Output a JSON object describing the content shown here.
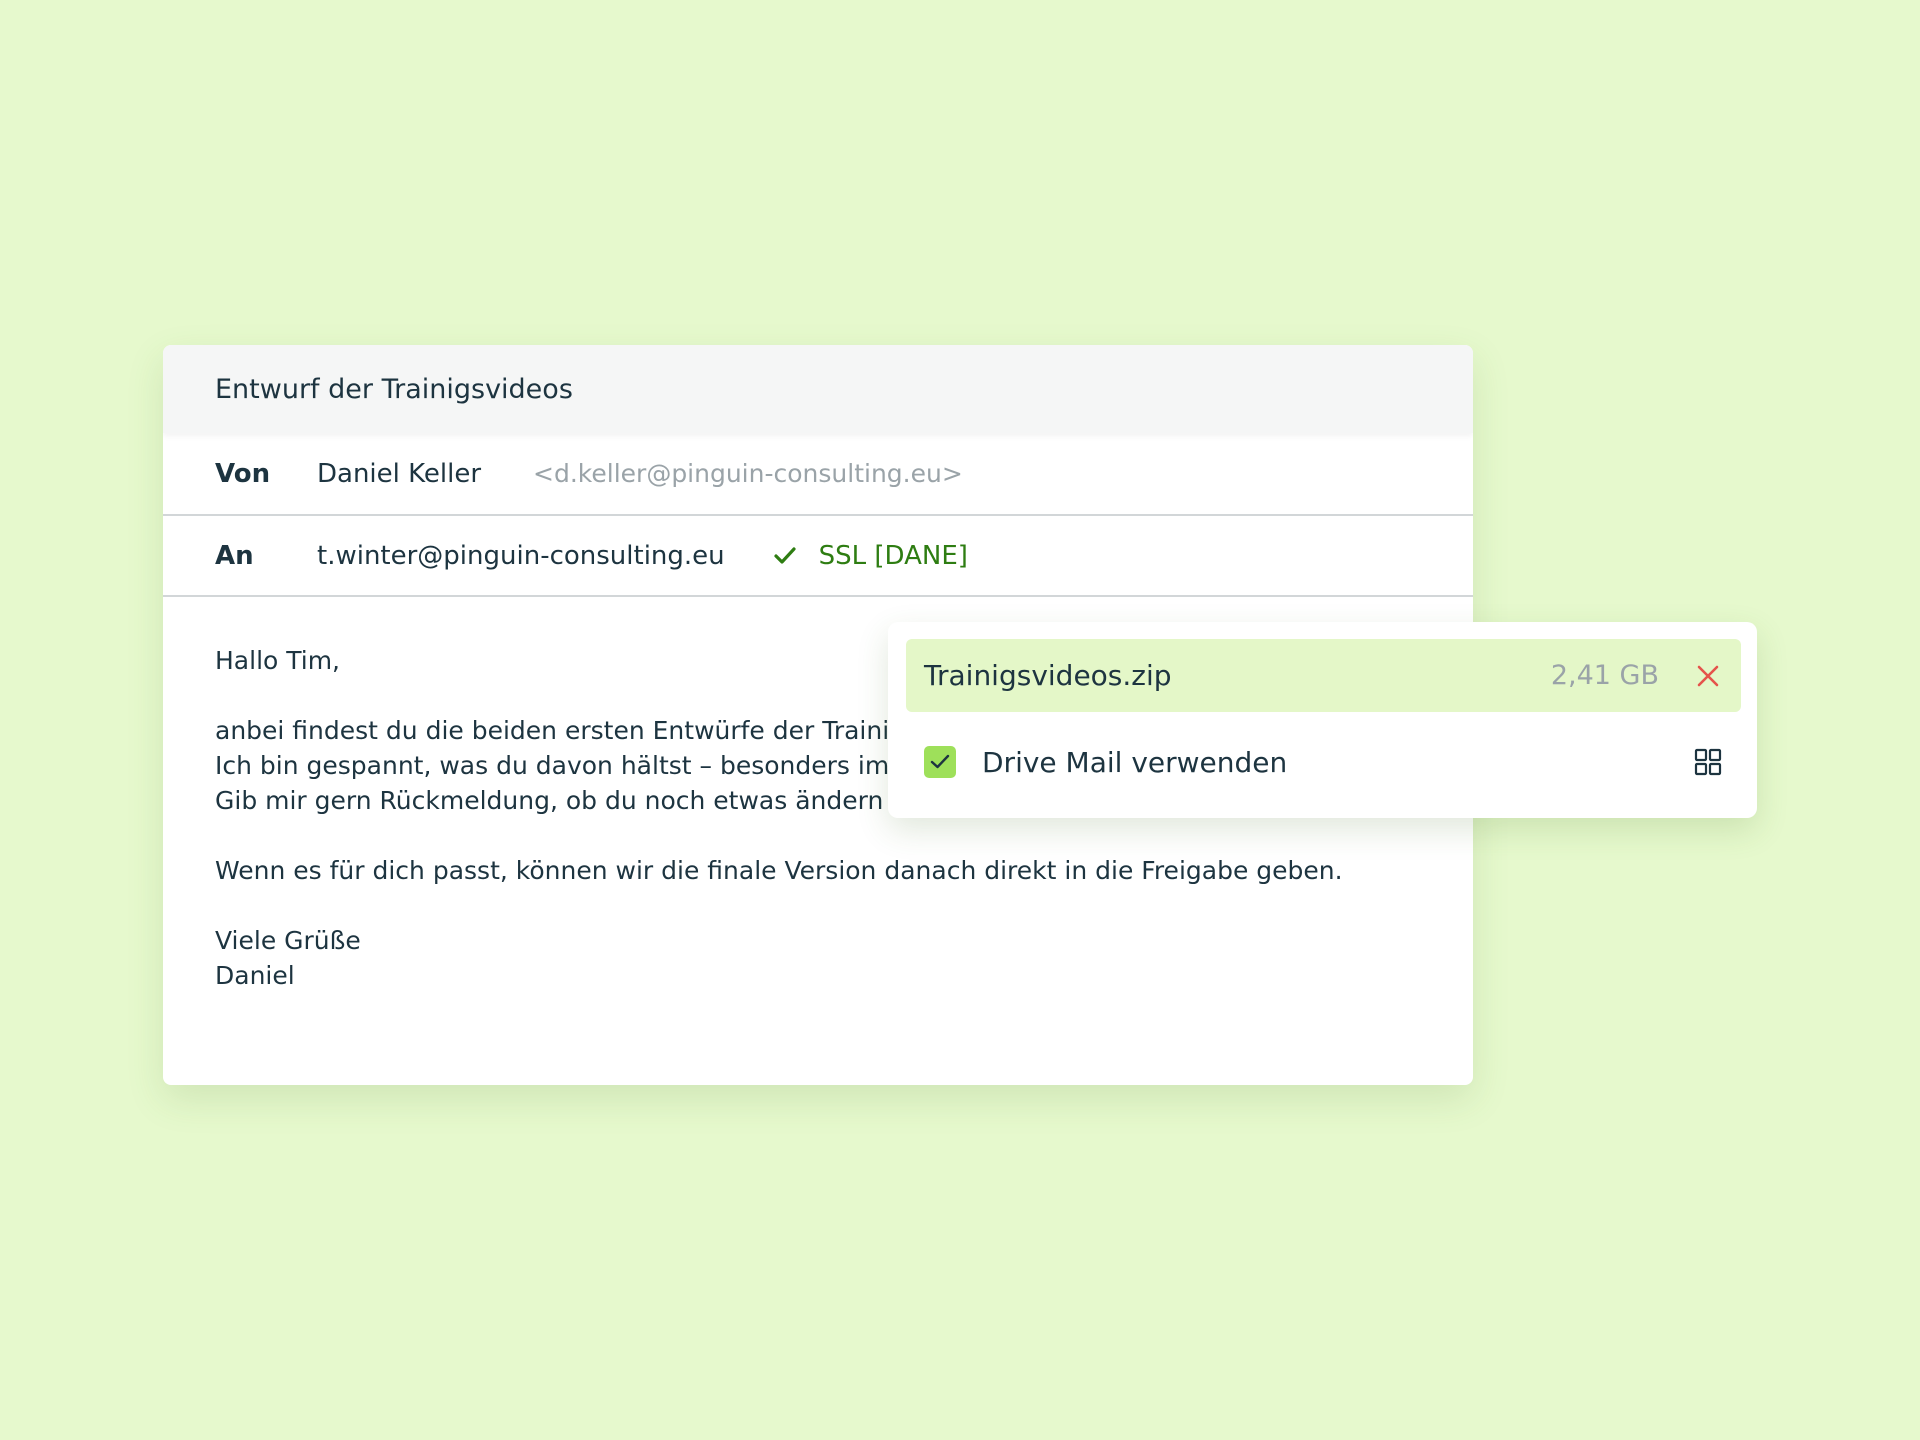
{
  "email": {
    "subject": "Entwurf der Trainigsvideos",
    "from": {
      "label": "Von",
      "name": "Daniel Keller",
      "address": "<d.keller@pinguin-consulting.eu>"
    },
    "to": {
      "label": "An",
      "address": "t.winter@pinguin-consulting.eu",
      "security": "SSL [DANE]"
    },
    "body": {
      "greeting": "Hallo Tim,",
      "line1": "anbei findest du die beiden ersten Entwürfe der Trainingsvideos.",
      "line2": "Ich bin gespannt, was du davon hältst – besonders im",
      "line3": "Gib mir gern Rückmeldung, ob du noch etwas ändern",
      "line4": "Wenn es für dich passt, können wir die finale Version danach direkt in die Freigabe geben.",
      "closing": "Viele Grüße",
      "signature": "Daniel"
    }
  },
  "attachment": {
    "file_name": "Trainigsvideos.zip",
    "file_size": "2,41 GB",
    "option_label": "Drive Mail verwenden",
    "option_checked": true
  },
  "colors": {
    "background": "#e6f9cd",
    "accent_green": "#9ee05a",
    "ssl_green": "#2e7d12",
    "remove_red": "#e5534b"
  },
  "icons": {
    "ssl": "check-icon",
    "remove": "close-icon",
    "checkbox": "checkmark-icon",
    "options": "grid-icon"
  }
}
